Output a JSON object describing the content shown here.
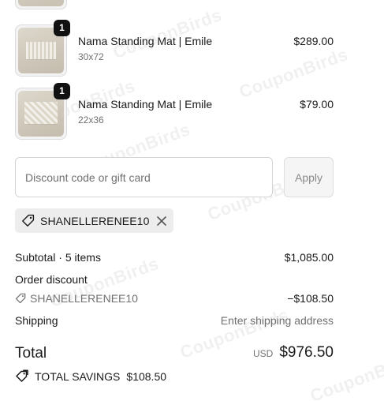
{
  "line_items": [
    {
      "title": "Nama Standing Mat | Emile",
      "variant": "30x72",
      "price": "$289.00",
      "quantity": "1"
    },
    {
      "title": "Nama Standing Mat | Emile",
      "variant": "22x36",
      "price": "$79.00",
      "quantity": "1"
    }
  ],
  "discount": {
    "placeholder": "Discount code or gift card",
    "apply_label": "Apply",
    "applied_code": "SHANELLERENEE10"
  },
  "summary": {
    "subtotal_label": "Subtotal · 5 items",
    "subtotal_value": "$1,085.00",
    "order_discount_label": "Order discount",
    "order_discount_code": "SHANELLERENEE10",
    "order_discount_value": "−$108.50",
    "shipping_label": "Shipping",
    "shipping_value": "Enter shipping address",
    "total_label": "Total",
    "total_currency": "USD",
    "total_value": "$976.50",
    "savings_label": "TOTAL SAVINGS",
    "savings_value": "$108.50"
  },
  "watermark_text": "CouponBirds",
  "icons": {
    "tag": "tag-icon",
    "close": "close-icon"
  },
  "colors": {
    "badge_bg": "#111111",
    "chip_bg": "#ededed",
    "muted_text": "#707070"
  }
}
